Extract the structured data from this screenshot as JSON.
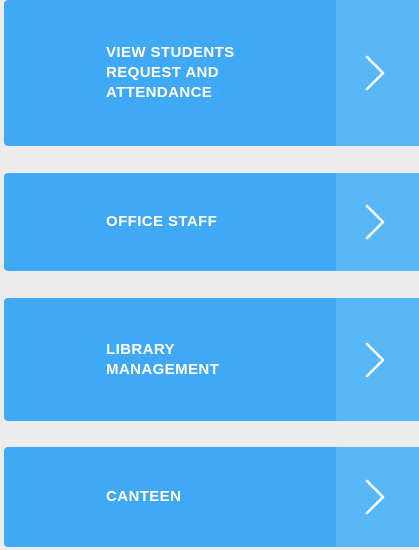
{
  "menu": {
    "items": [
      {
        "label": "VIEW STUDENTS\nREQUEST AND\nATTENDANCE",
        "icon": "chevron-right-icon"
      },
      {
        "label": "OFFICE STAFF",
        "icon": "chevron-right-icon"
      },
      {
        "label": "LIBRARY\nMANAGEMENT",
        "icon": "chevron-right-icon"
      },
      {
        "label": "CANTEEN",
        "icon": "chevron-right-icon"
      }
    ]
  },
  "colors": {
    "background": "#ececec",
    "item": "#3fa9f5",
    "arrow_panel": "#58b8f7",
    "text": "#ffffff"
  }
}
